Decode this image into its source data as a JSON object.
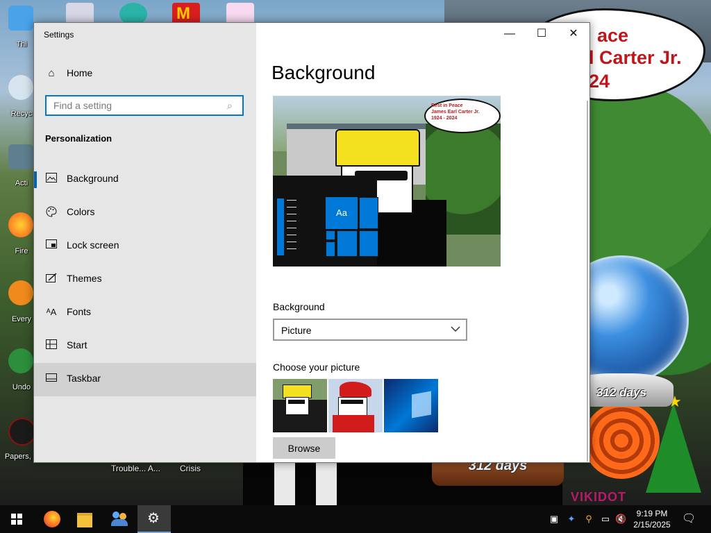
{
  "desktop": {
    "bubble_lines": [
      "ace",
      "l Carter Jr.",
      "24"
    ],
    "icons": [
      {
        "label": "Thi"
      },
      {
        "label": "Recyc"
      },
      {
        "label": "Acti"
      },
      {
        "label": "Fire"
      },
      {
        "label": "Every"
      },
      {
        "label": "Undo"
      },
      {
        "label": "Papers, P"
      }
    ],
    "bottom_labels": [
      "Trouble... A...",
      "Crisis"
    ],
    "globe1_text": "312 days",
    "globe2_text": "312 days",
    "watermark": "VIKIDOT"
  },
  "window": {
    "title": "Settings",
    "controls": {
      "minimize": "—",
      "maximize": "☐",
      "close": "✕"
    }
  },
  "sidebar": {
    "home": {
      "label": "Home",
      "icon": "home-icon"
    },
    "search_placeholder": "Find a setting",
    "section": "Personalization",
    "items": [
      {
        "label": "Background",
        "icon": "picture-icon"
      },
      {
        "label": "Colors",
        "icon": "palette-icon"
      },
      {
        "label": "Lock screen",
        "icon": "lock-screen-icon"
      },
      {
        "label": "Themes",
        "icon": "brush-icon"
      },
      {
        "label": "Fonts",
        "icon": "fonts-icon"
      },
      {
        "label": "Start",
        "icon": "start-icon"
      },
      {
        "label": "Taskbar",
        "icon": "taskbar-icon"
      }
    ]
  },
  "main": {
    "title": "Background",
    "preview": {
      "bubble_text": "Rest in Peace\nJames Earl Carter Jr.\n1924 - 2024",
      "tile_text": "Aa"
    },
    "background_label": "Background",
    "background_value": "Picture",
    "choose_label": "Choose your picture",
    "browse_label": "Browse"
  },
  "taskbar": {
    "apps": [
      "start",
      "firefox",
      "file-explorer",
      "people",
      "settings"
    ],
    "time": "9:19 PM",
    "date": "2/15/2025"
  }
}
